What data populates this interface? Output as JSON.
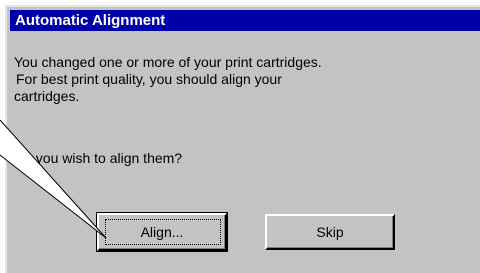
{
  "dialog": {
    "title": "Automatic Alignment",
    "message_lines": [
      "You changed one or more of your print cartridges.",
      "For best print quality, you should align your",
      "cartridges."
    ],
    "question": "Do you wish to align them?"
  },
  "buttons": {
    "align_label": "Align...",
    "skip_label": "Skip"
  },
  "colors": {
    "titlebar": "#0000a8",
    "dialog_face": "#c3c3c3",
    "title_text": "#ffffff"
  }
}
